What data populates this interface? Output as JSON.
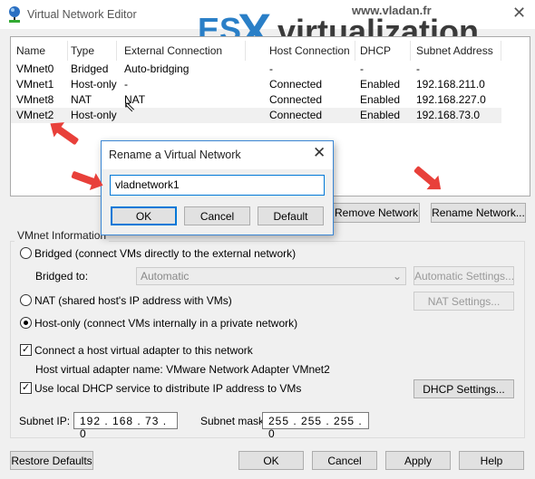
{
  "window": {
    "title": "Virtual Network Editor",
    "close": "✕"
  },
  "watermark": {
    "url": "www.vladan.fr",
    "logo_es": "ES",
    "logo_x": "X",
    "logo_rest": "virtualization"
  },
  "table": {
    "columns": [
      "Name",
      "Type",
      "External Connection",
      "Host Connection",
      "DHCP",
      "Subnet Address"
    ],
    "rows": [
      [
        "VMnet0",
        "Bridged",
        "Auto-bridging",
        "-",
        "-",
        "-"
      ],
      [
        "VMnet1",
        "Host-only",
        "-",
        "Connected",
        "Enabled",
        "192.168.211.0"
      ],
      [
        "VMnet8",
        "NAT",
        "NAT",
        "Connected",
        "Enabled",
        "192.168.227.0"
      ],
      [
        "VMnet2",
        "Host-only",
        "",
        "Connected",
        "Enabled",
        "192.168.73.0"
      ]
    ],
    "selected_row": 3
  },
  "list_buttons": {
    "remove": "Remove Network",
    "rename": "Rename Network..."
  },
  "dialog": {
    "title": "Rename a Virtual Network",
    "close": "✕",
    "value": "vladnetwork1",
    "ok": "OK",
    "cancel": "Cancel",
    "default": "Default"
  },
  "info": {
    "group_label": "VMnet Information",
    "bridged": "Bridged (connect VMs directly to the external network)",
    "bridged_to_label": "Bridged to:",
    "bridged_to_value": "Automatic",
    "auto_settings": "Automatic Settings...",
    "nat": "NAT (shared host's IP address with VMs)",
    "nat_settings": "NAT Settings...",
    "hostonly": "Host-only (connect VMs internally in a private network)",
    "selected_mode": "hostonly",
    "connect_adapter": "Connect a host virtual adapter to this network",
    "connect_adapter_checked": true,
    "adapter_name": "Host virtual adapter name: VMware Network Adapter VMnet2",
    "use_dhcp": "Use local DHCP service to distribute IP address to VMs",
    "use_dhcp_checked": true,
    "dhcp_settings": "DHCP Settings...",
    "subnet_ip_label": "Subnet IP:",
    "subnet_ip": "192 . 168 . 73 . 0",
    "subnet_mask_label": "Subnet mask:",
    "subnet_mask": "255 . 255 . 255 . 0"
  },
  "footer": {
    "restore": "Restore Defaults",
    "ok": "OK",
    "cancel": "Cancel",
    "apply": "Apply",
    "help": "Help"
  },
  "colors": {
    "accent": "#0078d7",
    "annotation_arrow": "#e8403a",
    "logo_blue": "#2a7fc7"
  }
}
